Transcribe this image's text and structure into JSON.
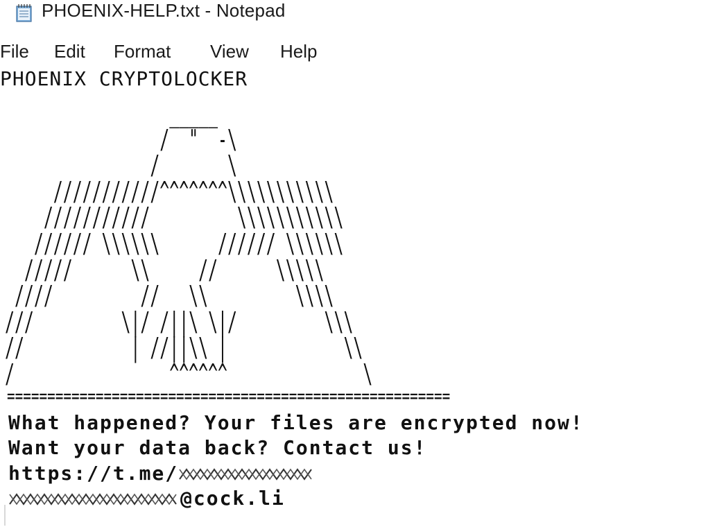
{
  "window": {
    "title": "PHOENIX-HELP.txt - Notepad",
    "icon": "notepad-icon"
  },
  "menu": {
    "items": [
      {
        "label": "File"
      },
      {
        "label": "Edit"
      },
      {
        "label": "Format"
      },
      {
        "label": "View"
      },
      {
        "label": "Help"
      }
    ]
  },
  "document": {
    "title": "PHOENIX CRYPTOLOCKER",
    "ascii_art": "                 _____\n                /  \"  -\\\n               /       \\\n     ///////////^^^^^^^\\\\\\\\\\\\\\\\\\\\\\\n    ///////////         \\\\\\\\\\\\\\\\\\\\\\\n   ////// \\\\\\\\\\\\      ////// \\\\\\\\\\\\\n  /////      \\\\     //      \\\\\\\\\\\n ////         //   \\\\         \\\\\\\\\n///         \\|/ /||\\ \\|/         \\\\\\\n//           | //||\\\\ |            \\\\\n/                ^^^^^^              \\",
    "divider": "=======================================================",
    "line1": "What happened? Your files are encrypted now!",
    "line2": "Want your data back? Contact us!",
    "line3_visible": "https://t.me/",
    "line4_visible": "@cock.li"
  }
}
